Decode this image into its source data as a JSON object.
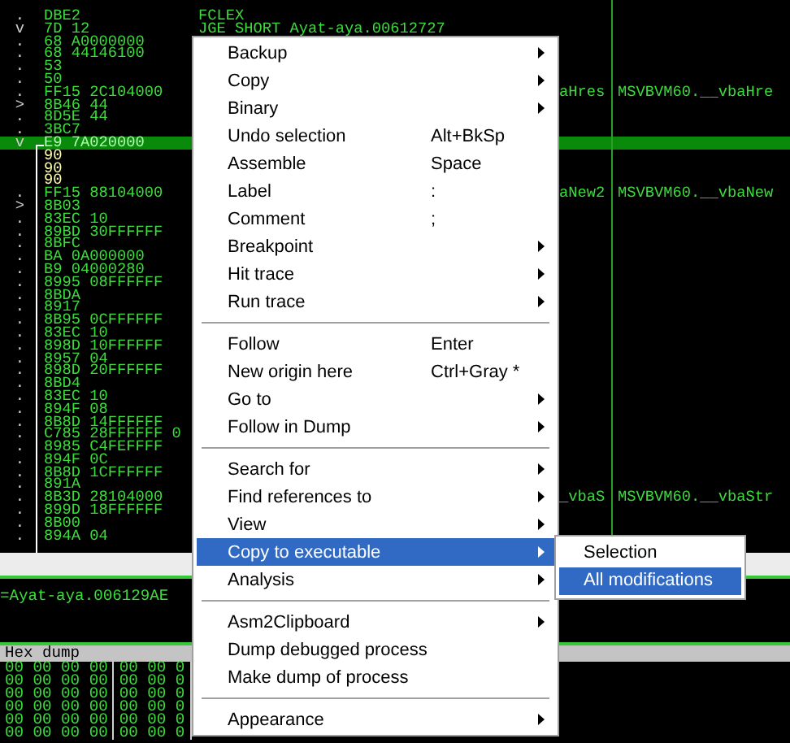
{
  "disassembly": {
    "rows": [
      {
        "mark": ".",
        "hex": "DBE2",
        "asm": "FCLEX",
        "selected": false,
        "kind": "code"
      },
      {
        "mark": "v",
        "hex": "7D 12",
        "asm": "JGE SHORT Ayat-aya.00612727",
        "selected": false,
        "kind": "code"
      },
      {
        "mark": ".",
        "hex": "68 A0000000",
        "selected": false,
        "kind": "code"
      },
      {
        "mark": ".",
        "hex": "68 44146100",
        "selected": false,
        "kind": "code"
      },
      {
        "mark": ".",
        "hex": "53",
        "selected": false,
        "kind": "code"
      },
      {
        "mark": ".",
        "hex": "50",
        "selected": false,
        "kind": "code"
      },
      {
        "mark": ".",
        "hex": "FF15 2C104000",
        "comment": "aHres",
        "arg": "MSVBVM60.__vbaHre",
        "selected": false,
        "kind": "code"
      },
      {
        "mark": ">",
        "hex": "8B46 44",
        "selected": false,
        "kind": "code"
      },
      {
        "mark": ".",
        "hex": "8D5E 44",
        "selected": false,
        "kind": "code"
      },
      {
        "mark": ".",
        "hex": "3BC7",
        "selected": false,
        "kind": "code"
      },
      {
        "mark": "v",
        "hex": "E9 7A020000",
        "selected": true,
        "kind": "code"
      },
      {
        "hex": "90",
        "selected": false,
        "kind": "patched"
      },
      {
        "hex": "90",
        "selected": false,
        "kind": "patched"
      },
      {
        "hex": "90",
        "selected": false,
        "kind": "patched"
      },
      {
        "mark": ".",
        "hex": "FF15 88104000",
        "comment": "aNew2",
        "arg": "MSVBVM60.__vbaNew",
        "selected": false,
        "kind": "code"
      },
      {
        "mark": ">",
        "hex": "8B03",
        "selected": false,
        "kind": "code"
      },
      {
        "mark": ".",
        "hex": "83EC 10",
        "selected": false,
        "kind": "code"
      },
      {
        "mark": ".",
        "hex": "89BD 30FFFFFF",
        "selected": false,
        "kind": "code"
      },
      {
        "mark": ".",
        "hex": "8BFC",
        "selected": false,
        "kind": "code"
      },
      {
        "mark": ".",
        "hex": "BA 0A000000",
        "selected": false,
        "kind": "code"
      },
      {
        "mark": ".",
        "hex": "B9 04000280",
        "selected": false,
        "kind": "code"
      },
      {
        "mark": ".",
        "hex": "8995 08FFFFFF",
        "selected": false,
        "kind": "code"
      },
      {
        "mark": ".",
        "hex": "8BDA",
        "selected": false,
        "kind": "code"
      },
      {
        "mark": ".",
        "hex": "8917",
        "selected": false,
        "kind": "code"
      },
      {
        "mark": ".",
        "hex": "8B95 0CFFFFFF",
        "selected": false,
        "kind": "code"
      },
      {
        "mark": ".",
        "hex": "83EC 10",
        "selected": false,
        "kind": "code"
      },
      {
        "mark": ".",
        "hex": "898D 10FFFFFF",
        "selected": false,
        "kind": "code"
      },
      {
        "mark": ".",
        "hex": "8957 04",
        "selected": false,
        "kind": "code"
      },
      {
        "mark": ".",
        "hex": "898D 20FFFFFF",
        "selected": false,
        "kind": "code"
      },
      {
        "mark": ".",
        "hex": "8BD4",
        "selected": false,
        "kind": "code"
      },
      {
        "mark": ".",
        "hex": "83EC 10",
        "selected": false,
        "kind": "code"
      },
      {
        "mark": ".",
        "hex": "894F 08",
        "selected": false,
        "kind": "code"
      },
      {
        "mark": ".",
        "hex": "8B8D 14FFFFFF",
        "selected": false,
        "kind": "code"
      },
      {
        "mark": ".",
        "hex": "C785 28FFFFFF 0",
        "selected": false,
        "kind": "code"
      },
      {
        "mark": ".",
        "hex": "8985 C4FEFFFF",
        "selected": false,
        "kind": "code"
      },
      {
        "mark": ".",
        "hex": "894F 0C",
        "selected": false,
        "kind": "code"
      },
      {
        "mark": ".",
        "hex": "8B8D 1CFFFFFF",
        "selected": false,
        "kind": "code"
      },
      {
        "mark": ".",
        "hex": "891A",
        "selected": false,
        "kind": "code"
      },
      {
        "mark": ".",
        "hex": "8B3D 28104000",
        "comment": "_vbaS",
        "arg": "MSVBVM60.__vbaStr",
        "selected": false,
        "kind": "code"
      },
      {
        "mark": ".",
        "hex": "899D 18FFFFFF",
        "selected": false,
        "kind": "code"
      },
      {
        "mark": ".",
        "hex": "8B00",
        "selected": false,
        "kind": "code"
      },
      {
        "mark": ".",
        "hex": "894A 04",
        "selected": false,
        "kind": "code"
      }
    ]
  },
  "info": {
    "text": "=Ayat-aya.006129AE"
  },
  "hex_dump": {
    "title": "Hex dump",
    "rows": [
      [
        "00 00 00 00",
        "00 00 0"
      ],
      [
        "00 00 00 00",
        "00 00 0"
      ],
      [
        "00 00 00 00",
        "00 00 0"
      ],
      [
        "00 00 00 00",
        "00 00 0"
      ],
      [
        "00 00 00 00",
        "00 00 0"
      ],
      [
        "00 00 00 00",
        "00 00 0"
      ]
    ]
  },
  "context_menu": {
    "items": [
      {
        "kind": "item",
        "label": "Backup",
        "submenu": true,
        "selected": false
      },
      {
        "kind": "item",
        "label": "Copy",
        "submenu": true,
        "selected": false
      },
      {
        "kind": "item",
        "label": "Binary",
        "submenu": true,
        "selected": false
      },
      {
        "kind": "item",
        "label": "Undo selection",
        "shortcut": "Alt+BkSp",
        "selected": false
      },
      {
        "kind": "item",
        "label": "Assemble",
        "shortcut": "Space",
        "selected": false
      },
      {
        "kind": "item",
        "label": "Label",
        "shortcut": ":",
        "selected": false
      },
      {
        "kind": "item",
        "label": "Comment",
        "shortcut": ";",
        "selected": false
      },
      {
        "kind": "item",
        "label": "Breakpoint",
        "submenu": true,
        "selected": false
      },
      {
        "kind": "item",
        "label": "Hit trace",
        "submenu": true,
        "selected": false
      },
      {
        "kind": "item",
        "label": "Run trace",
        "submenu": true,
        "selected": false
      },
      {
        "kind": "separator"
      },
      {
        "kind": "item",
        "label": "Follow",
        "shortcut": "Enter",
        "selected": false
      },
      {
        "kind": "item",
        "label": "New origin here",
        "shortcut": "Ctrl+Gray *",
        "selected": false
      },
      {
        "kind": "item",
        "label": "Go to",
        "submenu": true,
        "selected": false
      },
      {
        "kind": "item",
        "label": "Follow in Dump",
        "submenu": true,
        "selected": false
      },
      {
        "kind": "separator"
      },
      {
        "kind": "item",
        "label": "Search for",
        "submenu": true,
        "selected": false
      },
      {
        "kind": "item",
        "label": "Find references to",
        "submenu": true,
        "selected": false
      },
      {
        "kind": "item",
        "label": "View",
        "submenu": true,
        "selected": false
      },
      {
        "kind": "item",
        "label": "Copy to executable",
        "submenu": true,
        "selected": true
      },
      {
        "kind": "item",
        "label": "Analysis",
        "submenu": true,
        "selected": false
      },
      {
        "kind": "separator"
      },
      {
        "kind": "item",
        "label": "Asm2Clipboard",
        "submenu": true,
        "selected": false
      },
      {
        "kind": "item",
        "label": "Dump debugged process",
        "selected": false
      },
      {
        "kind": "item",
        "label": "Make dump of process",
        "selected": false
      },
      {
        "kind": "separator"
      },
      {
        "kind": "item",
        "label": "Appearance",
        "submenu": true,
        "selected": false
      }
    ]
  },
  "submenu": {
    "items": [
      {
        "label": "Selection",
        "selected": false
      },
      {
        "label": "All modifications",
        "selected": true
      }
    ]
  }
}
